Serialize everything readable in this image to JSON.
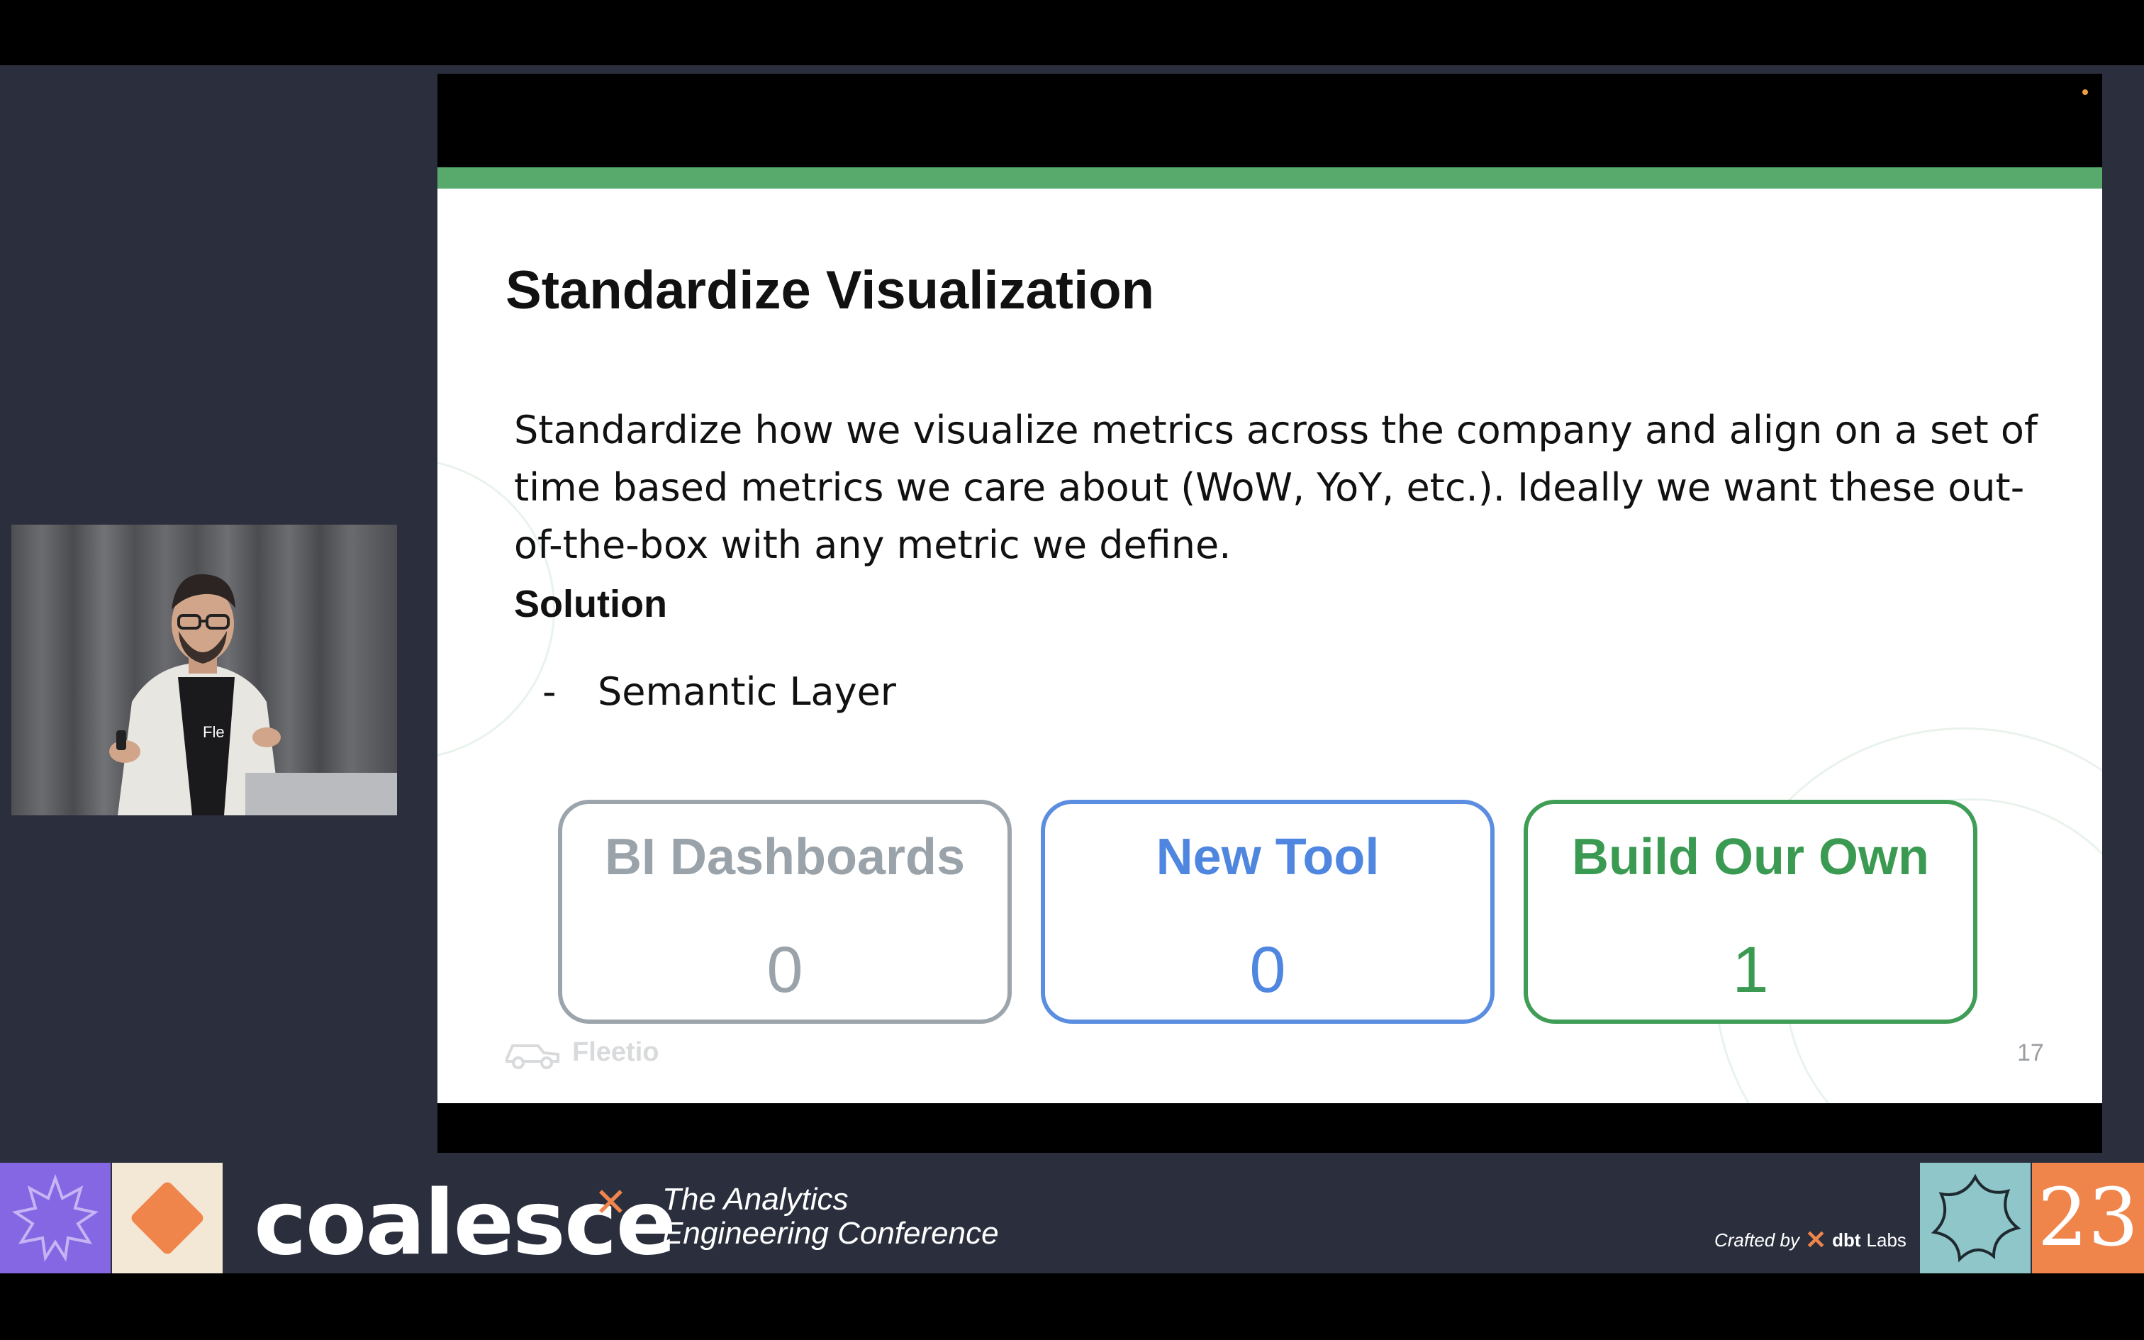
{
  "slide": {
    "title": "Standardize Visualization",
    "paragraph": "Standardize how we visualize metrics across the company and align on a set of time based metrics we care about (WoW, YoY, etc.). Ideally we want these out-of-the-box with any metric we define.",
    "solution_heading": "Solution",
    "bullets": [
      {
        "marker": "-",
        "text": "Semantic Layer"
      }
    ],
    "options": [
      {
        "title": "BI Dashboards",
        "count": "0",
        "color": "#9aa3aa"
      },
      {
        "title": "New Tool",
        "count": "0",
        "color": "#4f86df"
      },
      {
        "title": "Build Our Own",
        "count": "1",
        "color": "#3a9a52"
      }
    ],
    "footer_logo": "Fleetio",
    "page_number": "17",
    "accent_color": "#57aa6c"
  },
  "speaker_shirt_text": "Fle",
  "banner": {
    "wordmark": "coalesce",
    "tagline_line1": "The Analytics",
    "tagline_line2": "Engineering Conference",
    "crafted_label": "Crafted by",
    "crafted_brand": "dbt",
    "crafted_suffix": "Labs",
    "year": "23",
    "colors": {
      "purple": "#8667e3",
      "cream": "#f3e7d6",
      "teal": "#8fc6c9",
      "orange": "#f0854c"
    }
  }
}
